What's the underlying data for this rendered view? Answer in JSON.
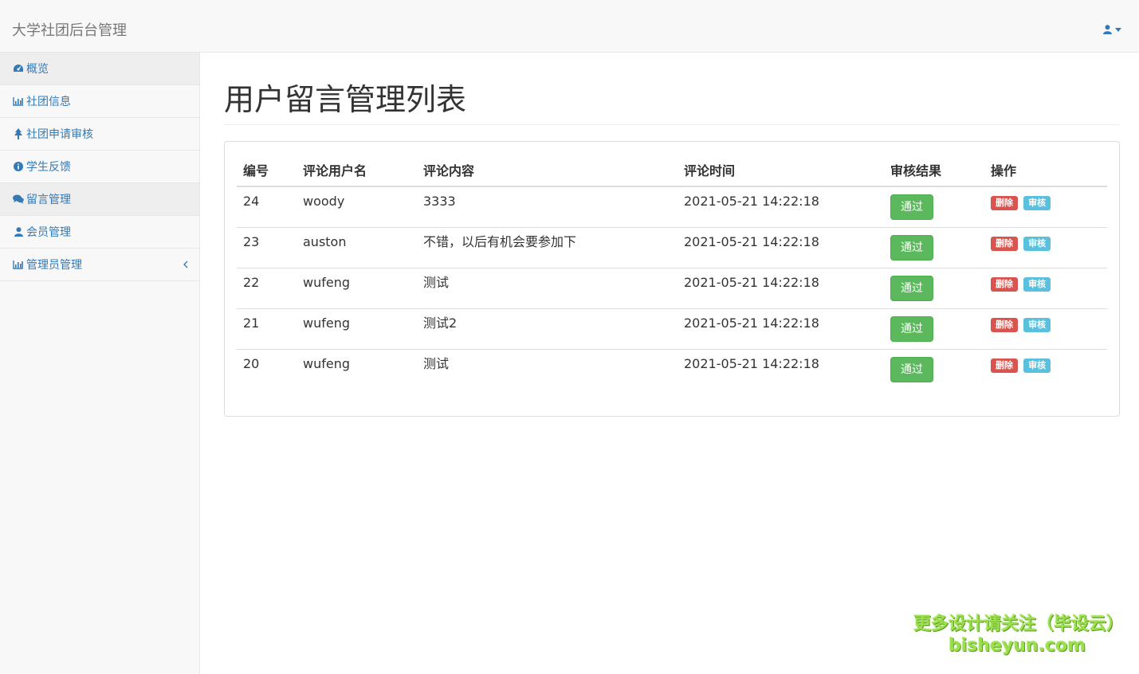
{
  "navbar": {
    "brand": "大学社团后台管理",
    "user_icon": "user-icon",
    "caret_icon": "caret-down-icon"
  },
  "sidebar": {
    "items": [
      {
        "label": "概览",
        "icon": "dashboard-icon",
        "active": true
      },
      {
        "label": "社团信息",
        "icon": "bar-chart-icon",
        "active": false
      },
      {
        "label": "社团申请审核",
        "icon": "tree-icon",
        "active": false
      },
      {
        "label": " 学生反馈",
        "icon": "info-circle-icon",
        "active": false
      },
      {
        "label": "留言管理",
        "icon": "comments-icon",
        "active": true
      },
      {
        "label": " 会员管理",
        "icon": "user-icon",
        "active": false
      },
      {
        "label": " 管理员管理",
        "icon": "bar-chart-icon",
        "active": false
      }
    ]
  },
  "main": {
    "title": "用户留言管理列表",
    "table": {
      "headers": [
        "编号",
        "评论用户名",
        "评论内容",
        "评论时间",
        "审核结果",
        "操作"
      ],
      "rows": [
        {
          "id": "24",
          "user": "woody",
          "content": "3333",
          "time": "2021-05-21 14:22:18",
          "result": "通过"
        },
        {
          "id": "23",
          "user": "auston",
          "content": "不错，以后有机会要参加下",
          "time": "2021-05-21 14:22:18",
          "result": "通过"
        },
        {
          "id": "22",
          "user": "wufeng",
          "content": "测试",
          "time": "2021-05-21 14:22:18",
          "result": "通过"
        },
        {
          "id": "21",
          "user": "wufeng",
          "content": "测试2",
          "time": "2021-05-21 14:22:18",
          "result": "通过"
        },
        {
          "id": "20",
          "user": "wufeng",
          "content": "测试",
          "time": "2021-05-21 14:22:18",
          "result": "通过"
        }
      ],
      "delete_label": "删除",
      "review_label": "审核"
    }
  },
  "watermark": {
    "line1": "更多设计请关注（毕设云）",
    "line2": "bisheyun.com"
  },
  "colors": {
    "success": "#5cb85c",
    "danger": "#d9534f",
    "info": "#5bc0de",
    "link": "#337ab7"
  }
}
